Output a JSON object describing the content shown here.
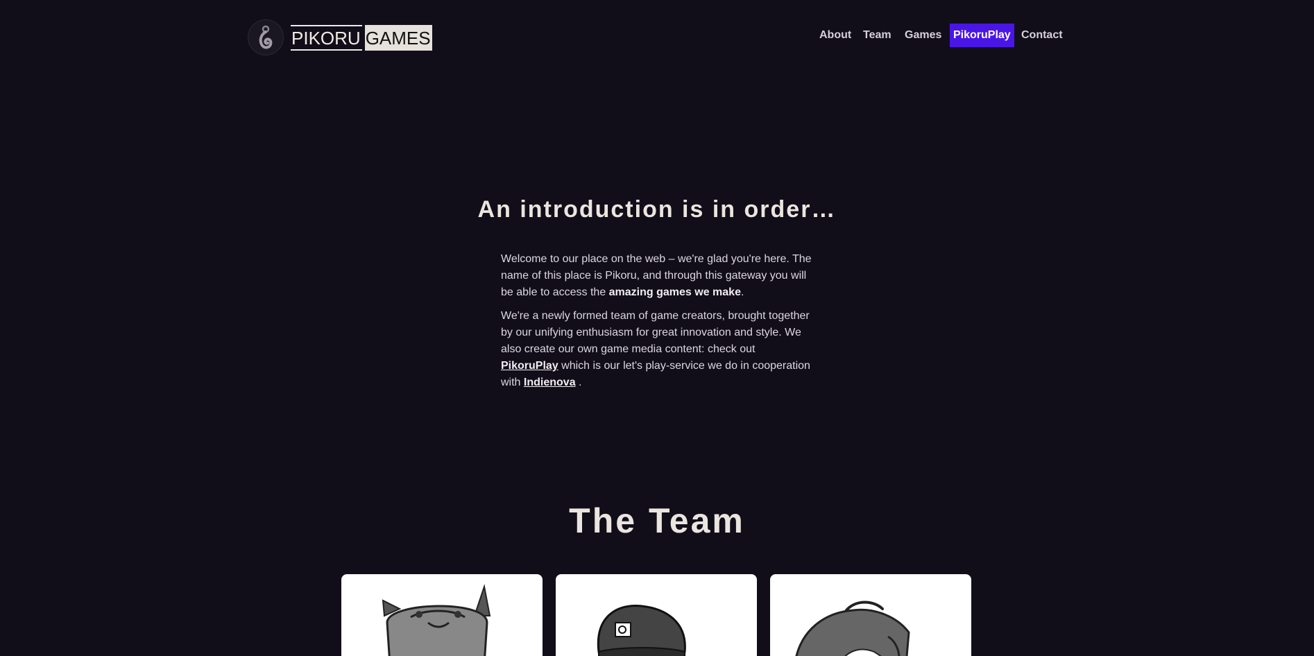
{
  "brand": {
    "word1": "PIKORU",
    "word2": "GAMES"
  },
  "nav": {
    "items": [
      {
        "label": "About"
      },
      {
        "label": "Team"
      },
      {
        "label": "Games"
      },
      {
        "label": "PikoruPlay",
        "active": true
      },
      {
        "label": "Contact"
      }
    ]
  },
  "intro": {
    "title": "An introduction is in order…",
    "p1_text": "Welcome to our place on the web – we're glad you're here. The name of this place is Pikoru, and through this gateway you will be able to access the ",
    "p1_bold": "amazing games we make",
    "p1_end": ".",
    "p2_text": "We're a newly formed team of game creators, brought together by our unifying enthusiasm for great innovation and style. We also create our own game media content: check out ",
    "p2_link1": "PikoruPlay",
    "p2_mid": " which is our let's play-service we do in cooperation with ",
    "p2_link2": "Indienova",
    "p2_end": " ."
  },
  "team": {
    "title": "The Team",
    "members": [
      {
        "avatar": "cat-portrait"
      },
      {
        "avatar": "beanie-portrait"
      },
      {
        "avatar": "hair-portrait"
      }
    ]
  },
  "colors": {
    "background": "#110e19",
    "accent": "#4a16e6",
    "text": "#e8e2ec"
  }
}
